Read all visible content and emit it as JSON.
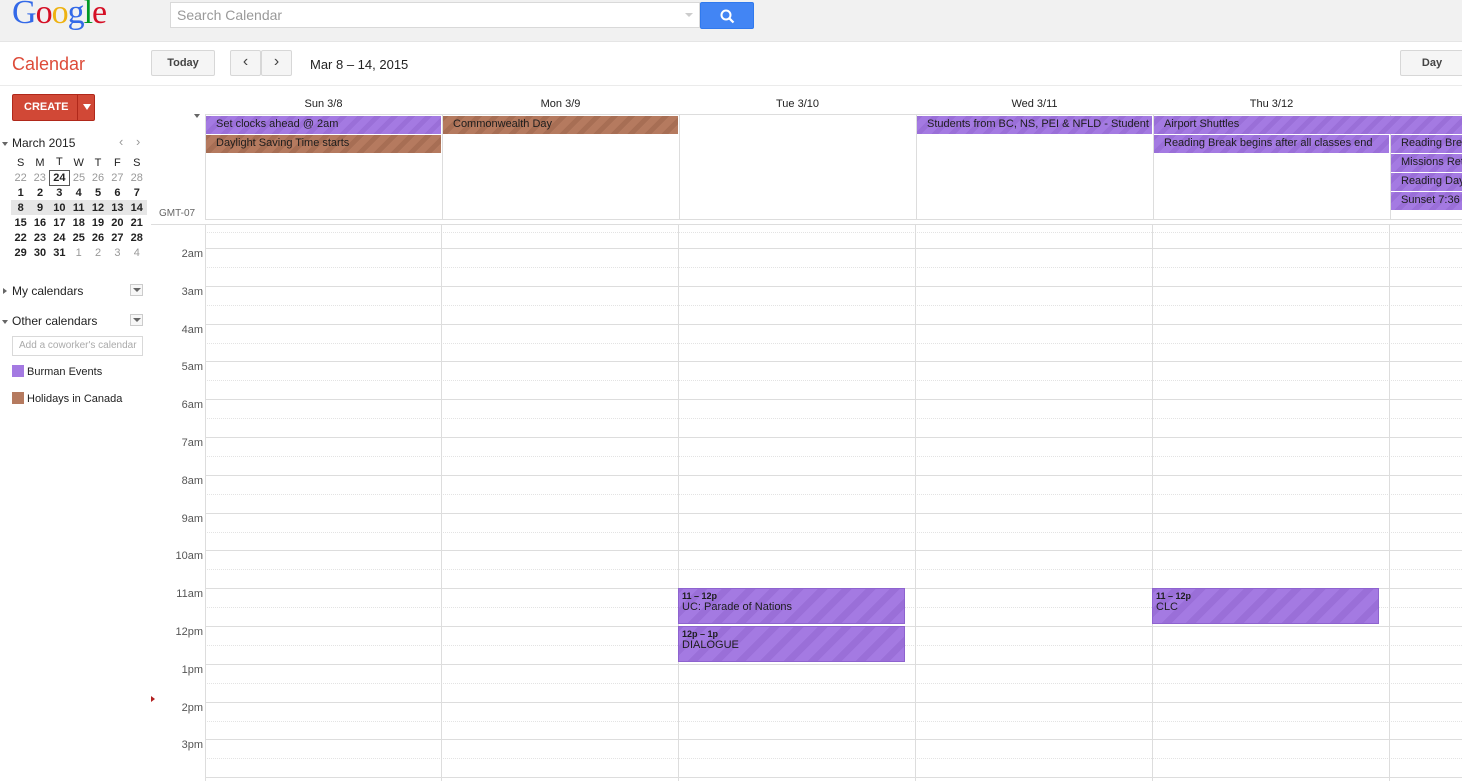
{
  "logo": {
    "letters": [
      "G",
      "o",
      "o",
      "g",
      "l",
      "e"
    ]
  },
  "search": {
    "placeholder": "Search Calendar"
  },
  "app_title": "Calendar",
  "toolbar": {
    "today": "Today",
    "prev": "‹",
    "next": "›",
    "date_range": "Mar 8 – 14, 2015",
    "day": "Day"
  },
  "create": {
    "label": "CREATE"
  },
  "mini_calendar": {
    "title": "March 2015",
    "dow": [
      "S",
      "M",
      "T",
      "W",
      "T",
      "F",
      "S"
    ],
    "weeks": [
      [
        "22",
        "23",
        "24",
        "25",
        "26",
        "27",
        "28"
      ],
      [
        "1",
        "2",
        "3",
        "4",
        "5",
        "6",
        "7"
      ],
      [
        "8",
        "9",
        "10",
        "11",
        "12",
        "13",
        "14"
      ],
      [
        "15",
        "16",
        "17",
        "18",
        "19",
        "20",
        "21"
      ],
      [
        "22",
        "23",
        "24",
        "25",
        "26",
        "27",
        "28"
      ],
      [
        "29",
        "30",
        "31",
        "1",
        "2",
        "3",
        "4"
      ]
    ]
  },
  "sections": {
    "my_calendars": "My calendars",
    "other_calendars": "Other calendars",
    "coworker_placeholder": "Add a coworker's calendar"
  },
  "calendars": [
    {
      "name": "Burman Events",
      "color": "#a47ae2"
    },
    {
      "name": "Holidays in Canada",
      "color": "#b57a5f"
    }
  ],
  "days": [
    "Sun 3/8",
    "Mon 3/9",
    "Tue 3/10",
    "Wed 3/11",
    "Thu 3/12"
  ],
  "timezone": "GMT-07",
  "allday_events": {
    "set_clocks": "Set clocks ahead @ 2am",
    "dst": "Daylight Saving Time starts",
    "commonwealth": "Commonwealth Day",
    "students": "Students from BC, NS, PEI & NFLD - Student",
    "airport": "Airport Shuttles",
    "reading_break": "Reading Break begins after all classes end",
    "reading_brea": "Reading Brea",
    "missions": "Missions Retr",
    "reading_day": "Reading Day",
    "sunset": "Sunset 7:36"
  },
  "hours": [
    "2am",
    "3am",
    "4am",
    "5am",
    "6am",
    "7am",
    "8am",
    "9am",
    "10am",
    "11am",
    "12pm",
    "1pm",
    "2pm",
    "3pm"
  ],
  "timed_events": {
    "parade": {
      "time": "11 – 12p",
      "title": "UC: Parade of Nations"
    },
    "dialogue": {
      "time": "12p – 1p",
      "title": "DIALOGUE"
    },
    "clc": {
      "time": "11 – 12p",
      "title": "CLC"
    }
  },
  "colors": {
    "accent": "#dd4b39",
    "search_blue": "#4285f4",
    "burman": "#a47ae2",
    "holidays": "#b57a5f"
  }
}
